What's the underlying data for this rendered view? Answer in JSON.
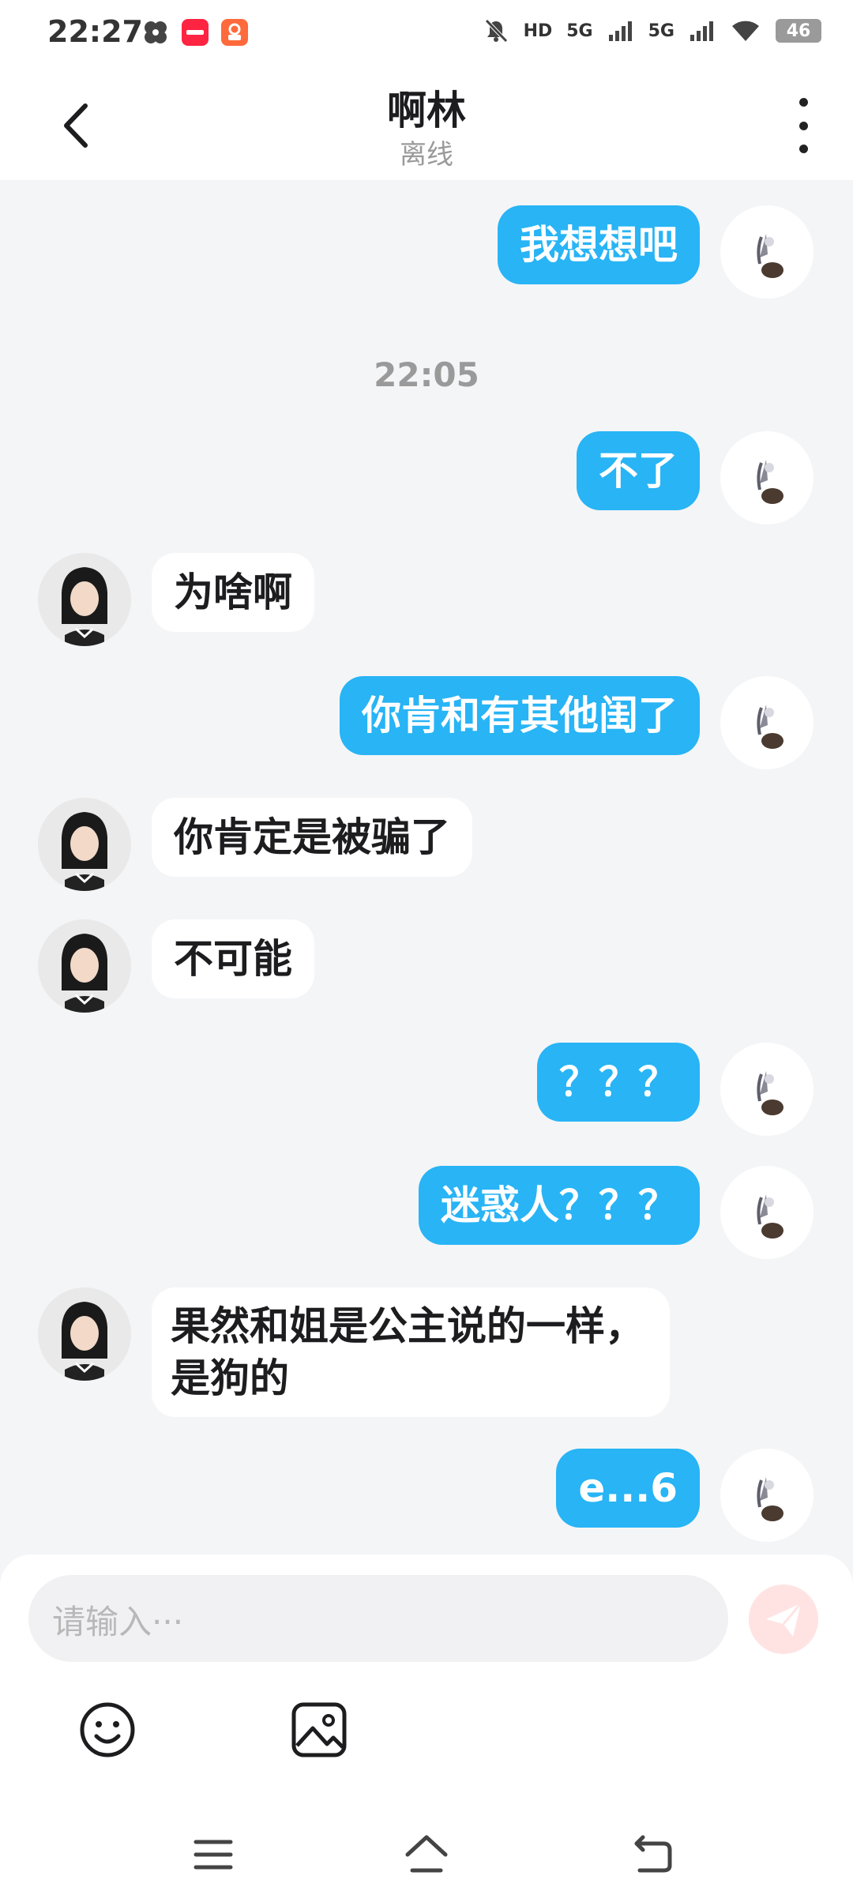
{
  "status_bar": {
    "time": "22:27",
    "hd": "HD",
    "net1": "5G",
    "net2": "5G",
    "battery": "46"
  },
  "header": {
    "title": "啊林",
    "subtitle": "离线"
  },
  "messages": {
    "m1": "我想想吧",
    "time1": "22:05",
    "m2": "不了",
    "m3": "为啥啊",
    "m4": "你肯和有其他闺了",
    "m5": "你肯定是被骗了",
    "m6": "不可能",
    "m7": "？？？",
    "m8": "迷惑人？？？",
    "m9": "果然和姐是公主说的一样，是狗的",
    "m10": "e...6"
  },
  "input": {
    "placeholder": "请输入···"
  },
  "colors": {
    "outgoing_bubble": "#28b4f5",
    "incoming_bubble": "#ffffff",
    "background": "#f4f5f7"
  }
}
